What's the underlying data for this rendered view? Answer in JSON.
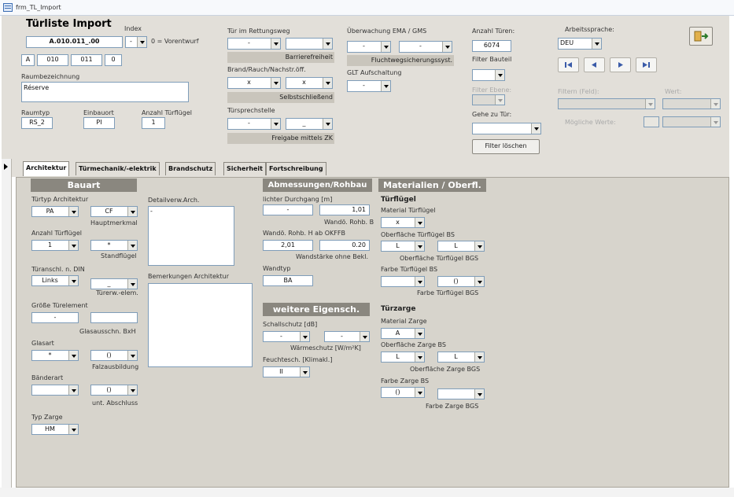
{
  "window": {
    "title": "frm_TL_Import"
  },
  "header": {
    "title": "Türliste Import",
    "index_label": "Index",
    "code": "A.010.011_.00",
    "index_value": "-",
    "index_hint": "0 = Vorentwurf",
    "parts": [
      "A",
      "010",
      "011",
      "0"
    ],
    "raumbezeichnung_label": "Raumbezeichnung",
    "raumbezeichnung": "Réserve",
    "raumtyp_label": "Raumtyp",
    "raumtyp": "RS_2",
    "einbauort_label": "Einbauort",
    "einbauort": "PI",
    "anzahl_fluegel_label": "Anzahl Türflügel",
    "anzahl_fluegel": "1"
  },
  "col2": {
    "rettungsweg_label": "Tür im Rettungsweg",
    "rettungsweg_value": "-",
    "rettungsweg_value2": "",
    "barrierefreiheit": "Barrierefreiheit",
    "brand_label": "Brand/Rauch/Nachstr.öff.",
    "brand_value": "x",
    "brand_value2": "x",
    "selbstschliessend": "Selbstschließend",
    "tuersprech_label": "Türsprechstelle",
    "tuersprech_value": "-",
    "tuersprech_value2": "_",
    "freigabe": "Freigabe mittels ZK"
  },
  "col3": {
    "ueberwachung_label": "Überwachung EMA / GMS",
    "ueberwachung_value": "-",
    "ueberwachung_value2": "-",
    "fluchtweg": "Fluchtwegsicherungssyst.",
    "glt_label": "GLT Aufschaltung",
    "glt_value": "-"
  },
  "col4": {
    "anzahl_tueren_label": "Anzahl Türen:",
    "anzahl_tueren": "6074",
    "filter_bauteil_label": "Filter Bauteil",
    "filter_ebene_label": "Filter Ebene:",
    "gehe_zu_label": "Gehe zu Tür:",
    "filter_loeschen": "Filter löschen"
  },
  "col5": {
    "arbeitssprache_label": "Arbeitssprache:",
    "arbeitssprache": "DEU",
    "filtern_label": "Filtern (Feld):",
    "wert_label": "Wert:",
    "moegliche_label": "Mögliche Werte:"
  },
  "tabs": [
    "Architektur",
    "Türmechanik/-elektrik",
    "Brandschutz",
    "Sicherheit",
    "Fortschreibung"
  ],
  "bauart": {
    "header": "Bauart",
    "tuertyp_label": "Türtyp Architektur",
    "tuertyp": "PA",
    "tuertyp2": "CF",
    "hauptmerkmal": "Hauptmerkmal",
    "anzahl_label": "Anzahl Türflügel",
    "anzahl": "1",
    "anzahl2": "*",
    "standfluegel": "Standflügel",
    "anschlag_label": "Türanschl. n. DIN",
    "anschlag": "Links",
    "anschlag2": "_",
    "tuererw": "Türerw.-elem.",
    "groesse_label": "Größe Türelement",
    "groesse": "-",
    "glasausschn": "Glasausschn. BxH",
    "glasart_label": "Glasart",
    "glasart": "*",
    "glasart2": "()",
    "falzausbildung": "Falzausbildung",
    "baenderart_label": "Bänderart",
    "baenderart2": "()",
    "unt_abschluss": "unt. Abschluss",
    "typ_zarge_label": "Typ Zarge",
    "typ_zarge": "HM"
  },
  "detail": {
    "detailverw_label": "Detailverw.Arch.",
    "detailverw": "-",
    "bemerkungen_label": "Bemerkungen Architektur"
  },
  "abmessungen": {
    "header": "Abmessungen/Rohbau",
    "durchgang_label": "lichter Durchgang [m]",
    "durchgang1": "-",
    "durchgang2": "1,01",
    "rohb_b": "Wandö. Rohb. B",
    "rohb_h_label": "Wandö. Rohb. H ab OKFFB",
    "rohb_h": "2,01",
    "wandstaerke_value": "0.20",
    "wandstaerke": "Wandstärke ohne Bekl.",
    "wandtyp_label": "Wandtyp",
    "wandtyp": "BA"
  },
  "weitere": {
    "header": "weitere Eigensch.",
    "schallschutz_label": "Schallschutz [dB]",
    "schallschutz": "-",
    "waermeschutz_value": "-",
    "waermeschutz": "Wärmeschutz [W/m²K]",
    "feuchte_label": "Feuchtesch. [Klimakl.]",
    "feuchte": "II"
  },
  "materialien": {
    "header": "Materialien / Oberfl.",
    "tuerfluegel": "Türflügel",
    "material_fluegel_label": "Material Türflügel",
    "material_fluegel": "x",
    "oberflaeche_fluegel_bs_label": "Oberfläche Türflügel BS",
    "oberflaeche_fluegel_bs": "L",
    "oberflaeche_fluegel_bgs_value": "L",
    "oberflaeche_fluegel_bgs": "Oberfläche Türflügel BGS",
    "farbe_fluegel_bs_label": "Farbe Türflügel BS",
    "farbe_fluegel_bgs_value": "()",
    "farbe_fluegel_bgs": "Farbe Türflügel BGS",
    "tuerzarge": "Türzarge",
    "material_zarge_label": "Material Zarge",
    "material_zarge": "A",
    "oberflaeche_zarge_bs_label": "Oberfläche Zarge BS",
    "oberflaeche_zarge_bs": "L",
    "oberflaeche_zarge_bgs_value": "L",
    "oberflaeche_zarge_bgs": "Oberfläche Zarge BGS",
    "farbe_zarge_bs_label": "Farbe Zarge BS",
    "farbe_zarge_bs": "()",
    "farbe_zarge_bgs": "Farbe Zarge BGS"
  },
  "colors": {
    "background": "#e2dfd9",
    "section_header": "#8a877f",
    "nav_arrow": "#3a5ba8"
  }
}
